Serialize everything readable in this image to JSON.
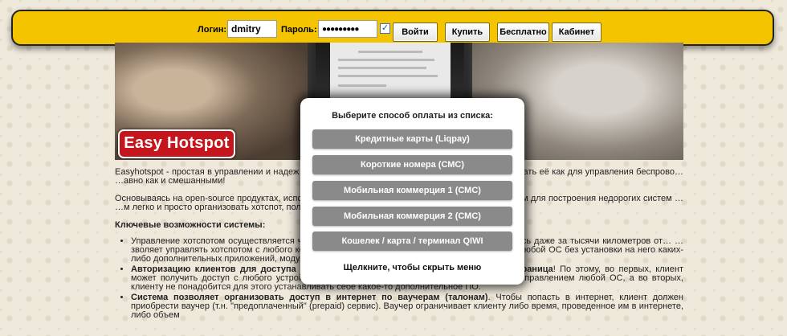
{
  "login_bar": {
    "login_label": "Логин:",
    "login_value": "dmitry",
    "password_label": "Пароль:",
    "password_value": "●●●●●●●●●",
    "remember_checked": true,
    "login_button": "Войти",
    "buy_button": "Купить",
    "free_button": "Бесплатно",
    "cabinet_button": "Кабинет"
  },
  "banner": {
    "logo_text": "Easy Hotspot"
  },
  "content": {
    "paragraphs": [
      "Easyhotspot - простая в управлении и надеж… …хотспота(ов). Кстати, ничто не мешает использовать её как для управления беспрово… …авно как и смешанными!",
      "Основываясь на open-source продуктах, испо… …емы, Easyhotspot является идеальным решением для построения недорогих систем … …м легко и просто организовать хотспот, полностью удовлетворяющий самым разнообр…"
    ],
    "features_heading": "Ключевые возможности системы:",
    "features": [
      {
        "bold": "",
        "text": "Управление хотспотом осуществляется ч… …правлять дистанционно через интернет, находясь даже за тысячи километров от… …зволяет управлять хотспотом с любого компьютера (или иного \"интернет-гаджет… …лением любой ОС без установки на него каких-либо дополнительных приложений, модулей, плагинов и т.д."
      },
      {
        "bold": "Авторизацию клиентов для доступа в интернет также осуществляет обычная веб страница",
        "text": "! По этому, во первых, клиент может получить доступ с любого устройства, имеющего любой браузер, работающий под управлением любой ОС, а во вторых, клиенту не понадобится для этого устанавливать себе какое-то дополнительное ПО."
      },
      {
        "bold": "Система позволяет организовать доступ в интернет по ваучерам (талонам)",
        "text": ". Чтобы попасть в интернет, клиент должен приобрести ваучер (т.н. \"предоплаченный\" (prepaid) сервис). Ваучер ограничивает клиенту либо время, проведенное им в интернете, либо объем"
      }
    ]
  },
  "payment_modal": {
    "title": "Выберите способ оплаты из списка:",
    "options": [
      "Кредитные карты (Liqpay)",
      "Короткие номера (СМС)",
      "Мобильная коммерция 1 (СМС)",
      "Мобильная коммерция 2 (СМС)",
      "Кошелек / карта / терминал QIWI"
    ],
    "hide_text": "Щелкните, чтобы скрыть меню"
  },
  "colors": {
    "bar_yellow": "#f4c400",
    "logo_red": "#c4161c",
    "pay_button_gray": "#8a8a8a"
  }
}
